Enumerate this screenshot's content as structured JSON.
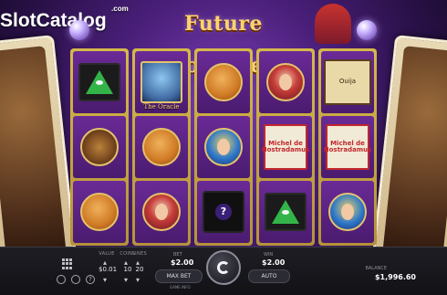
{
  "brand": {
    "name_part1": "Slot",
    "name_part2": "Catalog",
    "suffix": ".com"
  },
  "game": {
    "title": "Future Fortunes"
  },
  "reels": [
    [
      {
        "symbol": "pyramid-eye"
      },
      {
        "symbol": "gypsy-wagon"
      },
      {
        "symbol": "fortune-cookie"
      }
    ],
    [
      {
        "symbol": "the-oracle",
        "label": "The Oracle"
      },
      {
        "symbol": "fortune-cookie"
      },
      {
        "symbol": "gypsy-woman"
      }
    ],
    [
      {
        "symbol": "fortune-cookie"
      },
      {
        "symbol": "swami"
      },
      {
        "symbol": "magic-8-ball",
        "label": "?"
      }
    ],
    [
      {
        "symbol": "gypsy-woman"
      },
      {
        "symbol": "nostradamus",
        "label": "Michel de Nostradamus"
      },
      {
        "symbol": "pyramid-eye"
      }
    ],
    [
      {
        "symbol": "ouija-board",
        "label": "Ouija"
      },
      {
        "symbol": "nostradamus",
        "label": "Michel de Nostradamus"
      },
      {
        "symbol": "swami"
      }
    ]
  ],
  "controls": {
    "value_label": "VALUE",
    "value": "$0.01",
    "coins_label": "COINS",
    "coins": "10",
    "lines_label": "LINES",
    "lines": "20",
    "bet_label": "BET",
    "bet": "$2.00",
    "win_label": "WIN",
    "win": "$2.00",
    "max_bet": "MAX BET",
    "auto": "AUTO",
    "game_info": "GAME INFO",
    "balance_label": "BALANCE",
    "balance": "$1,996.60"
  }
}
